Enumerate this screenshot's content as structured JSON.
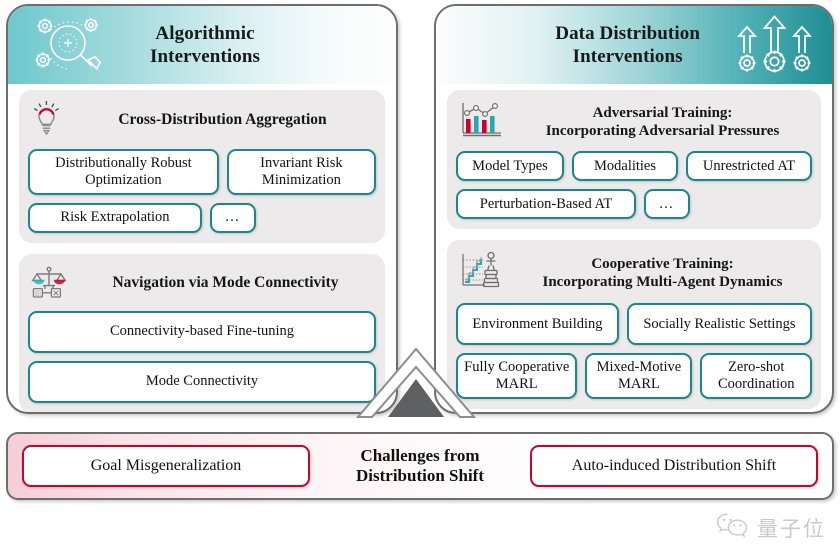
{
  "panels": [
    {
      "id": "algorithmic-interventions",
      "header": {
        "title_line1": "Algorithmic",
        "title_line2": "Interventions",
        "icon": "magnifier-gears-icon"
      },
      "sections": [
        {
          "id": "cross-distribution-aggregation",
          "icon": "lightbulb-icon",
          "title_line1": "Cross-Distribution Aggregation",
          "title_line2": "",
          "chips": [
            [
              "Distributionally Robust Optimization",
              "Invariant Risk Minimization"
            ],
            [
              "Risk Extrapolation",
              "…"
            ]
          ]
        },
        {
          "id": "navigation-via-mode-connectivity",
          "icon": "balance-scale-icon",
          "title_line1": "Navigation via Mode Connectivity",
          "title_line2": "",
          "chips": [
            [
              "Connectivity-based Fine-tuning"
            ],
            [
              "Mode Connectivity"
            ]
          ]
        }
      ]
    },
    {
      "id": "data-distribution-interventions",
      "header": {
        "title_line1": "Data Distribution",
        "title_line2": "Interventions",
        "icon": "arrows-gears-icon"
      },
      "sections": [
        {
          "id": "adversarial-training",
          "icon": "bar-line-chart-icon",
          "title_line1": "Adversarial Training:",
          "title_line2": "Incorporating Adversarial Pressures",
          "chips": [
            [
              "Model Types",
              "Modalities",
              "Unrestricted AT"
            ],
            [
              "Perturbation-Based AT",
              "…"
            ]
          ]
        },
        {
          "id": "cooperative-training",
          "icon": "agent-podium-chart-icon",
          "title_line1": "Cooperative Training:",
          "title_line2": "Incorporating Multi-Agent Dynamics",
          "chips": [
            [
              "Environment Building",
              "Socially Realistic Settings"
            ],
            [
              "Fully Cooperative MARL",
              "Mixed-Motive MARL",
              "Zero-shot Coordination"
            ]
          ]
        }
      ]
    }
  ],
  "bottom": {
    "left_chip": "Goal Misgeneralization",
    "title_line1": "Challenges from",
    "title_line2": "Distribution Shift",
    "right_chip": "Auto-induced Distribution Shift"
  },
  "watermark": {
    "text": "量子位",
    "icon": "wechat-icon"
  },
  "colors": {
    "teal": "#1b868c",
    "teal_header": "#1f8e95",
    "crimson": "#c9022f",
    "panel_border": "#6d6d6d",
    "section_bg": "#eceaea",
    "arrow_fill": "#5e6061"
  }
}
